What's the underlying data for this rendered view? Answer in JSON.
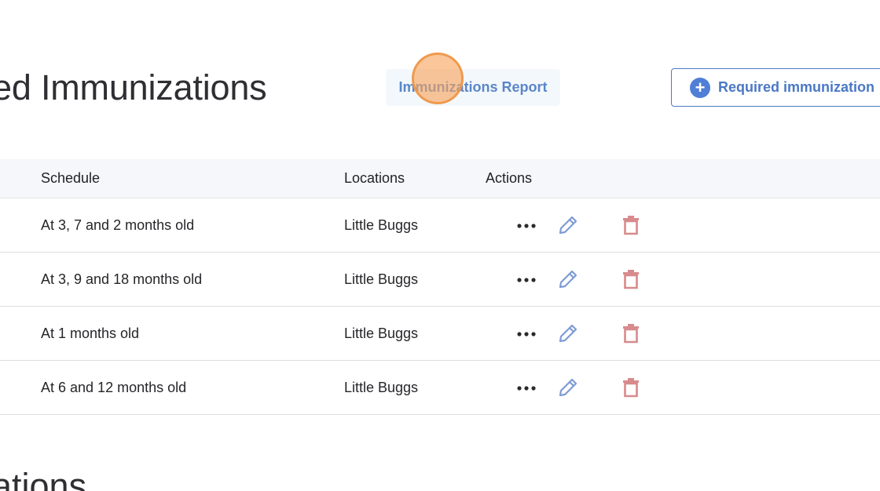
{
  "header": {
    "title": "ed Immunizations",
    "report_button_label": "Immunizations Report",
    "add_button_label": "Required immunization"
  },
  "table": {
    "columns": {
      "schedule": "Schedule",
      "locations": "Locations",
      "actions": "Actions"
    },
    "rows": [
      {
        "schedule": "At 3, 7 and 2 months old",
        "location": "Little Buggs"
      },
      {
        "schedule": "At 3, 9 and 18 months old",
        "location": "Little Buggs"
      },
      {
        "schedule": "At 1 months old",
        "location": "Little Buggs"
      },
      {
        "schedule": "At 6 and 12 months old",
        "location": "Little Buggs"
      }
    ]
  },
  "section2": {
    "title": "ations"
  },
  "icons": {
    "add": "plus-circle-icon",
    "more": "more-horizontal-icon",
    "edit": "pencil-icon",
    "delete": "trash-icon"
  },
  "colors": {
    "accent": "#4f7fd6",
    "edit_icon": "#7f9bd6",
    "delete_icon": "#d88a8c",
    "header_bg": "#f6f7fa"
  }
}
